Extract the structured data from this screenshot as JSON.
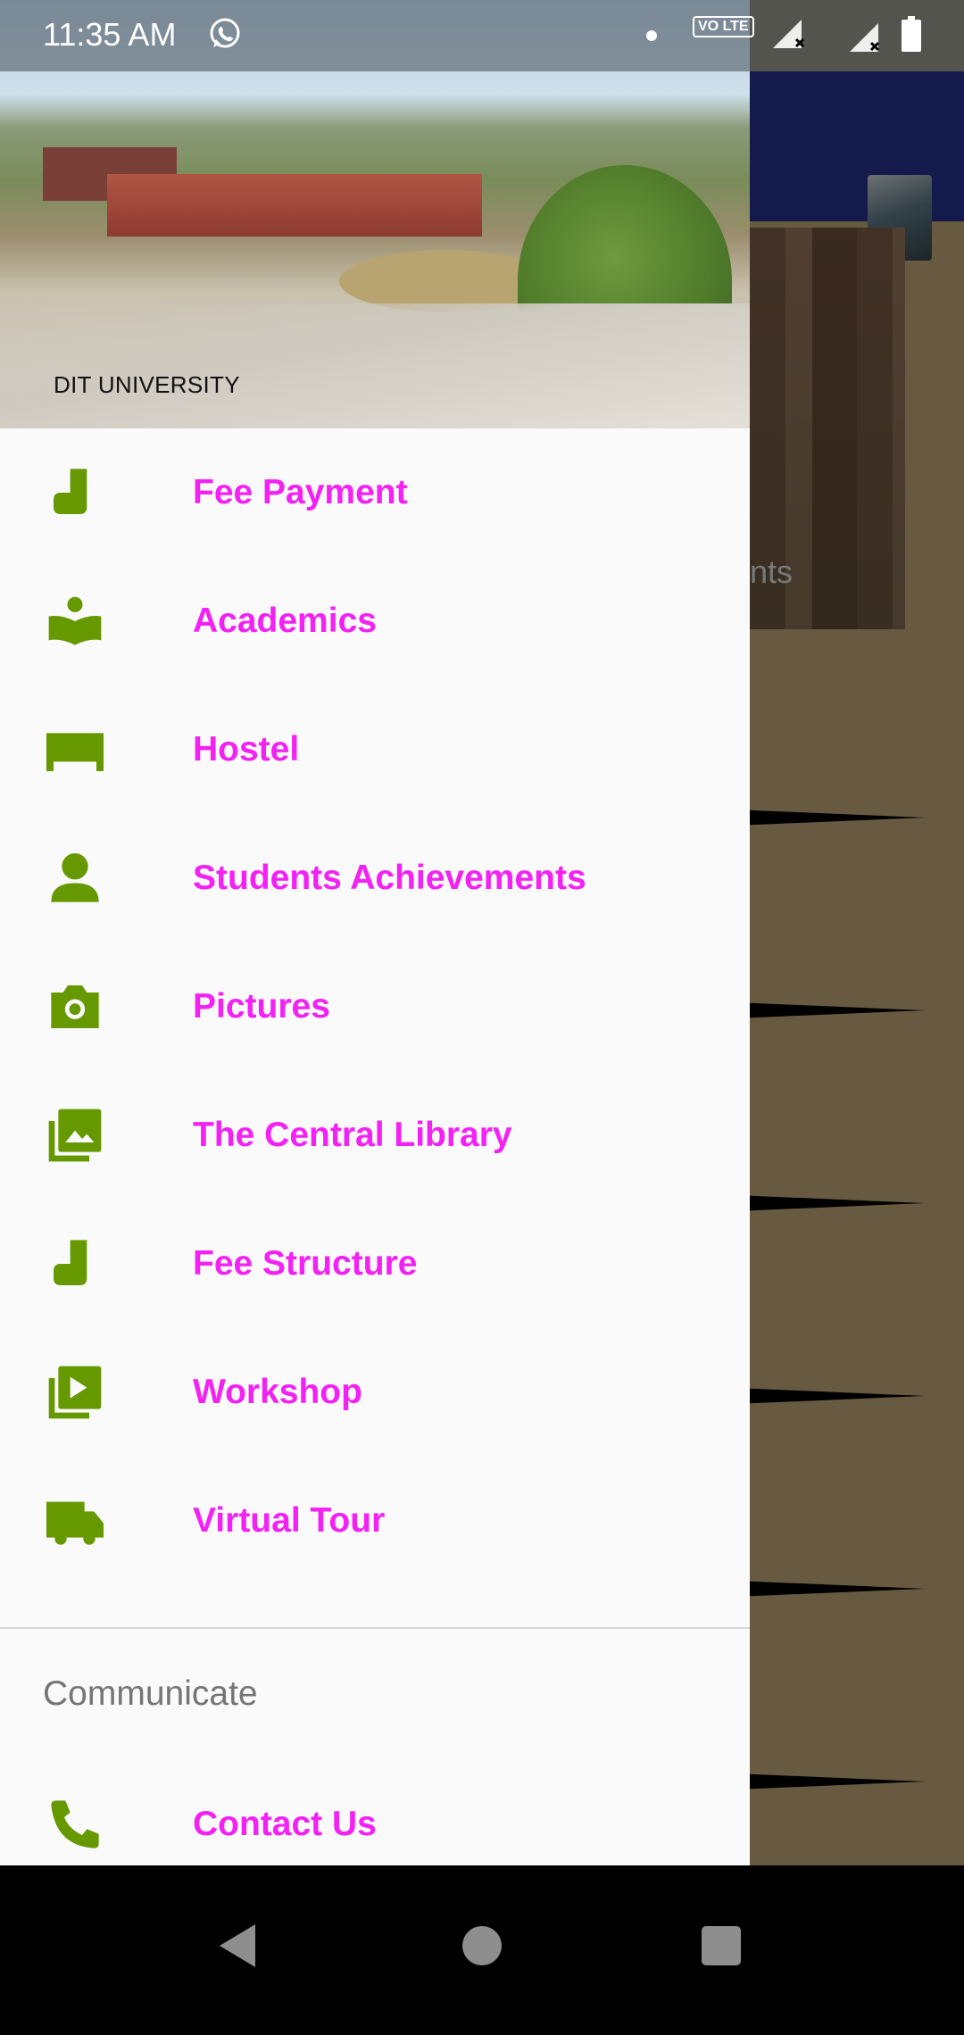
{
  "status_bar": {
    "time": "11:35 AM",
    "volte_label": "VO LTE",
    "icons": [
      "whatsapp-icon",
      "notification-dot-icon",
      "volte-icon",
      "signal-icon",
      "signal-icon",
      "battery-icon"
    ]
  },
  "background": {
    "banner_caption_fragment": "nts"
  },
  "drawer": {
    "header_title": "DIT UNIVERSITY",
    "icon_color": "#669900",
    "label_color": "#f321f3",
    "items": [
      {
        "label": "Fee Payment",
        "icon": "boot-icon"
      },
      {
        "label": "Academics",
        "icon": "reader-icon"
      },
      {
        "label": "Hostel",
        "icon": "bed-icon"
      },
      {
        "label": "Students Achievements",
        "icon": "person-icon"
      },
      {
        "label": "Pictures",
        "icon": "camera-icon"
      },
      {
        "label": "The Central Library",
        "icon": "gallery-icon"
      },
      {
        "label": "Fee Structure",
        "icon": "boot-icon"
      },
      {
        "label": "Workshop",
        "icon": "video-library-icon"
      },
      {
        "label": "Virtual Tour",
        "icon": "truck-icon"
      }
    ],
    "section_title": "Communicate",
    "contact": {
      "label": "Contact Us",
      "icon": "phone-icon"
    }
  },
  "nav_bar": {
    "icons": [
      "back-icon",
      "home-icon",
      "recents-icon"
    ]
  }
}
